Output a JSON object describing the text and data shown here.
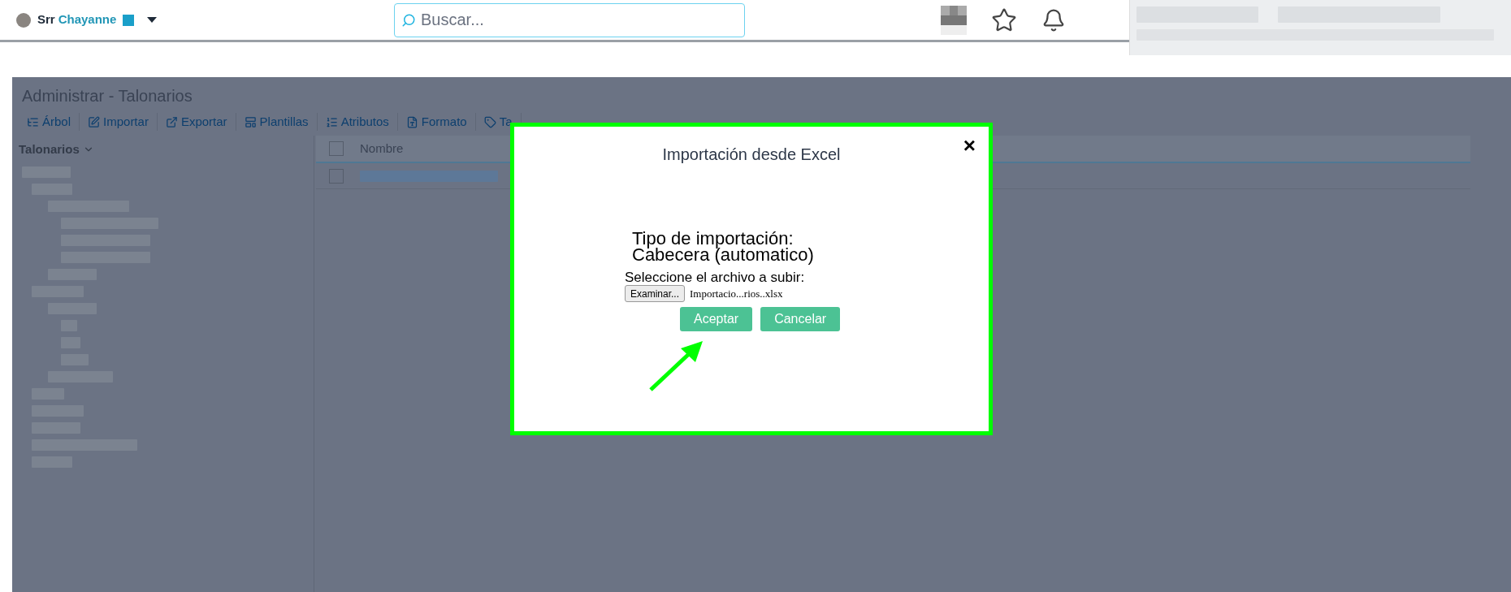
{
  "user": {
    "prefix": "Srr",
    "name": "Chayanne"
  },
  "search": {
    "placeholder": "Buscar..."
  },
  "page": {
    "title": "Administrar - Talonarios",
    "toolbar": [
      {
        "kind": "tree",
        "label": "Árbol"
      },
      {
        "kind": "edit",
        "label": "Importar"
      },
      {
        "kind": "export",
        "label": "Exportar"
      },
      {
        "kind": "template",
        "label": "Plantillas"
      },
      {
        "kind": "list",
        "label": "Atributos"
      },
      {
        "kind": "format",
        "label": "Formato"
      },
      {
        "kind": "tag",
        "label": "Ta"
      }
    ],
    "tree": {
      "header": "Talonarios"
    },
    "grid": {
      "columns": [
        "Nombre"
      ],
      "header_checked": false,
      "rows": [
        {
          "checked": false
        }
      ]
    }
  },
  "dialog": {
    "title": "Importación desde Excel",
    "close": "×",
    "import_type_label": "Tipo de importación:",
    "import_type_value": "Cabecera (automatico)",
    "file_label": "Seleccione el archivo a subir:",
    "browse_button": "Examinar...",
    "file_name": "Importacio...rios..xlsx",
    "buttons": [
      "Aceptar",
      "Cancelar"
    ]
  }
}
